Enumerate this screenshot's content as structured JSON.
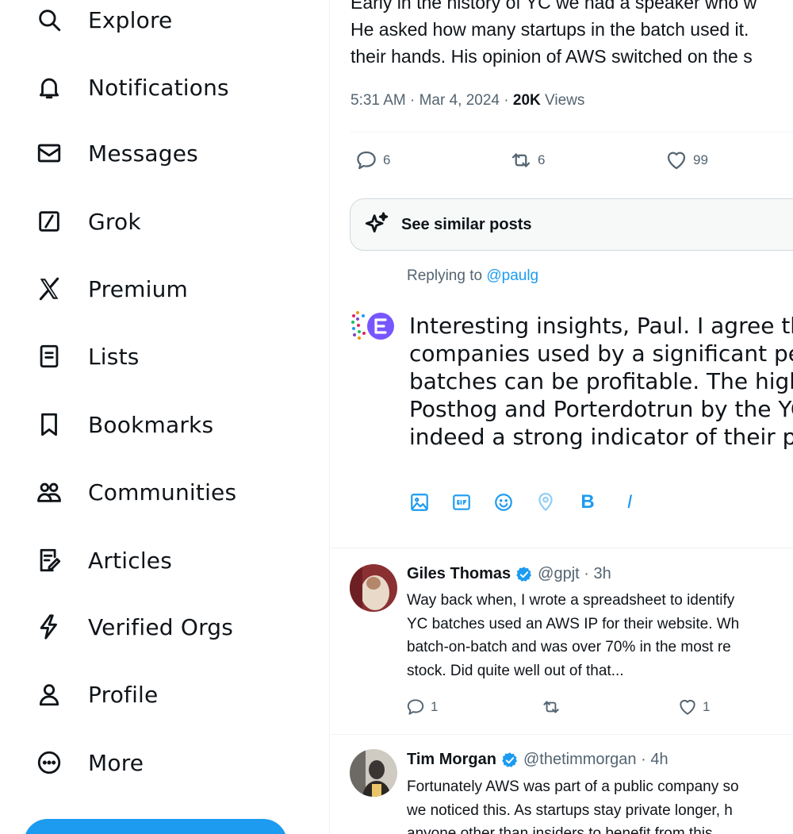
{
  "sidebar": {
    "items": [
      {
        "label": "Explore",
        "icon": "search-icon"
      },
      {
        "label": "Notifications",
        "icon": "bell-icon"
      },
      {
        "label": "Messages",
        "icon": "envelope-icon"
      },
      {
        "label": "Grok",
        "icon": "grok-icon"
      },
      {
        "label": "Premium",
        "icon": "x-logo-icon"
      },
      {
        "label": "Lists",
        "icon": "list-icon"
      },
      {
        "label": "Bookmarks",
        "icon": "bookmark-icon"
      },
      {
        "label": "Communities",
        "icon": "communities-icon"
      },
      {
        "label": "Articles",
        "icon": "article-icon"
      },
      {
        "label": "Verified Orgs",
        "icon": "lightning-icon"
      },
      {
        "label": "Profile",
        "icon": "person-icon"
      },
      {
        "label": "More",
        "icon": "more-circle-icon"
      }
    ]
  },
  "tweet": {
    "lines": [
      "Early in the history of YC we had a speaker who w",
      "He asked how many startups in the batch used it.",
      "their hands. His opinion of AWS switched on the s"
    ],
    "time": "5:31 AM · Mar 4, 2024 · ",
    "views_count": "20K",
    "views_label": " Views",
    "replies": "6",
    "reposts": "6",
    "likes": "99"
  },
  "similar_label": "See similar posts",
  "compose": {
    "replying_prefix": "Replying to ",
    "replying_handle": "@paulg",
    "lines": [
      "Interesting insights, Paul. I agree tha",
      "companies used by a significant perc",
      "batches can be profitable. The high a",
      "Posthog and Porterdotrun by the YC",
      "indeed a strong indicator of their pot"
    ],
    "tool_bold": "B",
    "tool_italic": "I"
  },
  "replies": [
    {
      "name": "Giles Thomas",
      "handle": "@gpjt · 3h",
      "lines": [
        "Way back when, I wrote a spreadsheet to identify",
        "YC  batches used an AWS IP for their website. Wh",
        "batch-on-batch and was over 70% in the most re",
        "stock. Did quite well out of that..."
      ],
      "reply_count": "1",
      "like_count": "1"
    },
    {
      "name": "Tim Morgan",
      "handle": "@thetimmorgan · 4h",
      "lines": [
        "Fortunately AWS was part of a public company so",
        "we noticed this. As startups stay private longer, h",
        "anyone other than insiders to benefit from this."
      ]
    }
  ],
  "colors": {
    "accent": "#1d9bf0",
    "text": "#0f1419",
    "muted": "#536471",
    "verified": "#1d9bf0"
  }
}
